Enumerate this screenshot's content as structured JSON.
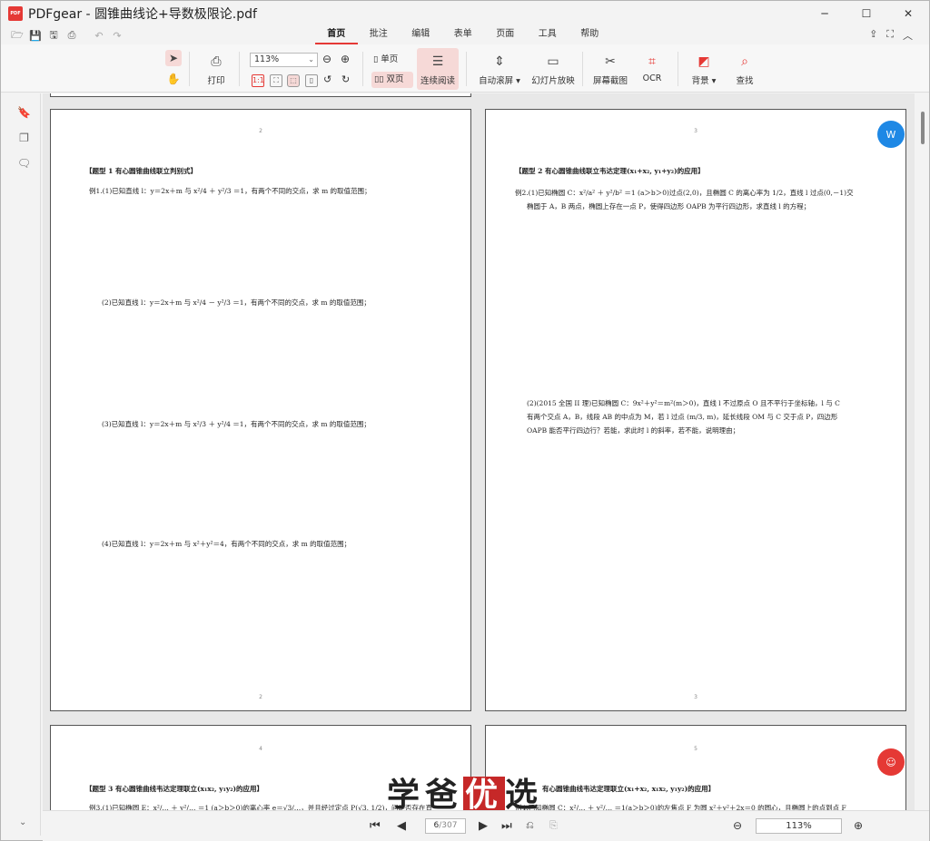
{
  "app": {
    "title": "PDFgear - 圆锥曲线论+导数极限论.pdf",
    "logo_text": "PDF"
  },
  "window_controls": [
    "─",
    "☐",
    "✕"
  ],
  "tabs": [
    "首页",
    "批注",
    "编辑",
    "表单",
    "页面",
    "工具",
    "帮助"
  ],
  "active_tab": "首页",
  "ribbon": {
    "print": "打印",
    "zoom": "113%",
    "single": "单页",
    "double": "双页",
    "continuous": "连续阅读",
    "autoscroll": "自动滚屏",
    "slideshow": "幻灯片放映",
    "screenshot": "屏幕截图",
    "ocr": "OCR",
    "background": "背景",
    "find": "查找"
  },
  "pages": {
    "p2": {
      "num": "2",
      "heading": "【题型 1 有心圆锥曲线联立判别式】",
      "q1": "例1.(1)已知直线 l：y＝2x＋m 与 x²/4 ＋ y²/3 ＝1，有两个不同的交点，求 m 的取值范围；",
      "q2": "(2)已知直线 l：y＝2x＋m 与 x²/4 － y²/3 ＝1，有两个不同的交点，求 m 的取值范围；",
      "q3": "(3)已知直线 l：y＝2x＋m 与 x²/3 ＋ y²/4 ＝1，有两个不同的交点，求 m 的取值范围；",
      "q4": "(4)已知直线 l：y＝2x＋m 与 x²＋y²＝4，有两个不同的交点，求 m 的取值范围；"
    },
    "p3": {
      "num": "3",
      "heading": "【题型 2 有心圆锥曲线联立韦达定理(x₁+x₂, y₁+y₂)的应用】",
      "q1a": "例2.(1)已知椭圆 C：x²/a² ＋ y²/b² ＝1 (a＞b＞0)过点(2,0)，且椭圆 C 的离心率为 1/2，直线 l 过点(0,－1)交",
      "q1b": "椭圆于 A，B 两点，椭圆上存在一点 P，使得四边形 OAPB 为平行四边形，求直线 l 的方程；",
      "q2a": "(2)(2015 全国 II 理)已知椭圆 C：9x²＋y²＝m²(m＞0)，直线 l 不过原点 O 且不平行于坐标轴，l 与 C",
      "q2b": "有两个交点 A，B，线段 AB 的中点为 M，若 l 过点 (m/3, m)，延长线段 OM 与 C 交于点 P，四边形",
      "q2c": "OAPB 能否平行四边行？若能，求此时 l 的斜率，若不能，说明理由；"
    },
    "p4": {
      "num": "4",
      "heading": "【题型 3 有心圆锥曲线韦达定理联立(x₁x₂, y₁y₂)的应用】",
      "q1": "例3.(1)已知椭圆 E：x²/… ＋ y²/… ＝1 (a＞b＞0)的离心率 e＝√3/…，并且经过定点 P(√3, 1/2)，问是否存在直"
    },
    "p5": {
      "num": "5",
      "heading": "有心圆锥曲线韦达定理联立(x₁+x₂, x₁x₂, y₁y₂)的应用】",
      "q1": "例4.已知椭圆 C：x²/… ＋ y²/… ＝1(a＞b＞0)的左焦点 F 为圆 x²＋y²＋2x＝0 的圆心，且椭圆上的点到点 F"
    }
  },
  "watermark": {
    "a": "学爸",
    "b": "优",
    "c": "选"
  },
  "status": {
    "page": "6",
    "total": "/307",
    "zoom": "113%"
  }
}
